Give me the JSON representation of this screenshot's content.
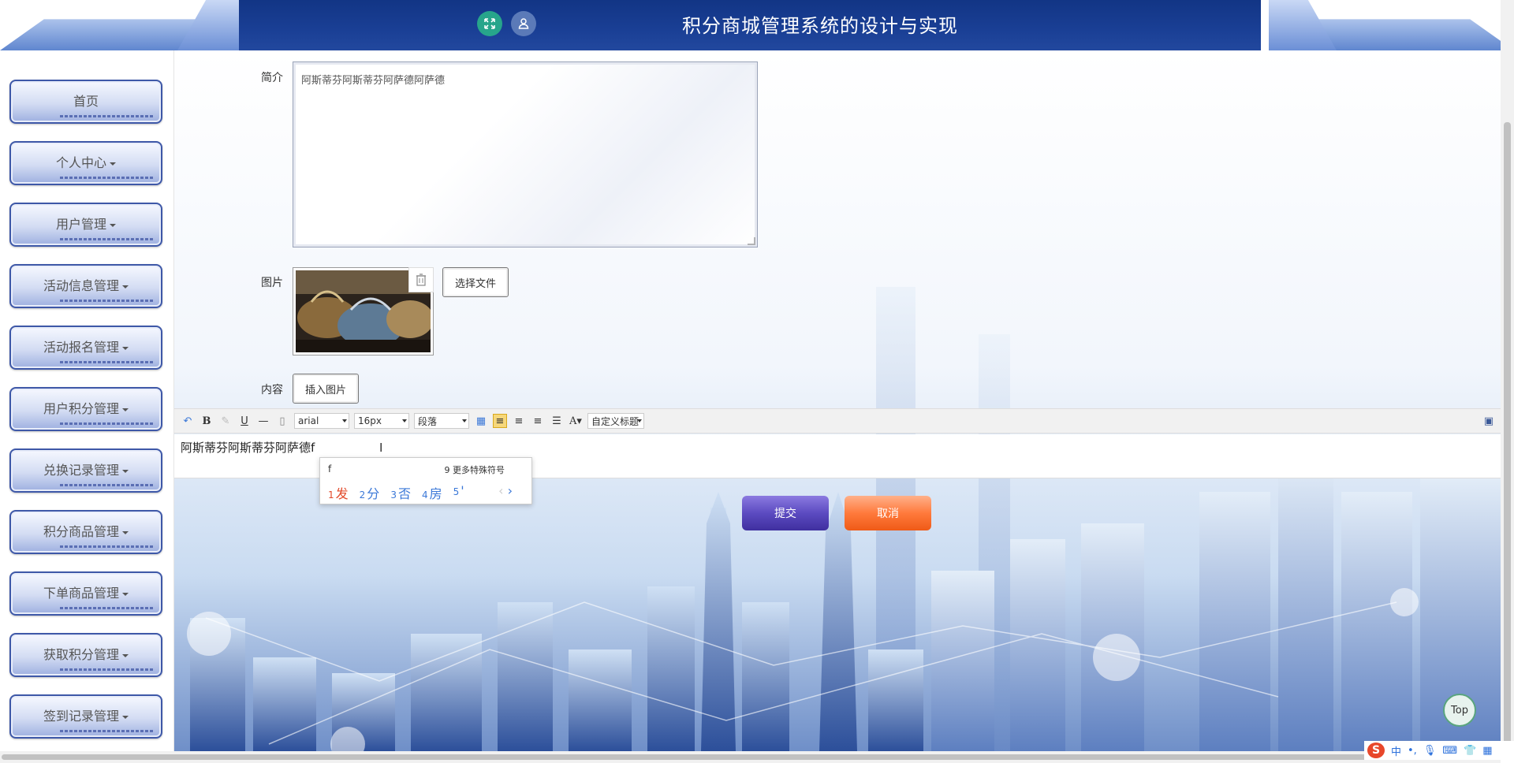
{
  "header": {
    "title": "积分商城管理系统的设计与实现",
    "fullscreen_icon": "expand-icon",
    "user_icon": "user-icon",
    "accent": "#1a3f95"
  },
  "sidebar": {
    "items": [
      {
        "label": "首页",
        "has_caret": false
      },
      {
        "label": "个人中心",
        "has_caret": true
      },
      {
        "label": "用户管理",
        "has_caret": true
      },
      {
        "label": "活动信息管理",
        "has_caret": true
      },
      {
        "label": "活动报名管理",
        "has_caret": true
      },
      {
        "label": "用户积分管理",
        "has_caret": true
      },
      {
        "label": "兑换记录管理",
        "has_caret": true
      },
      {
        "label": "积分商品管理",
        "has_caret": true
      },
      {
        "label": "下单商品管理",
        "has_caret": true
      },
      {
        "label": "获取积分管理",
        "has_caret": true
      },
      {
        "label": "签到记录管理",
        "has_caret": true
      }
    ]
  },
  "form": {
    "intro_label": "简介",
    "intro_value": "阿斯蒂芬阿斯蒂芬阿萨德阿萨德",
    "image_label": "图片",
    "choose_file": "选择文件",
    "content_label": "内容",
    "insert_image": "插入图片"
  },
  "toolbar": {
    "font_family": "arial",
    "font_size": "16px",
    "paragraph": "段落",
    "custom_title": "自定义标题"
  },
  "editor": {
    "content": "阿斯蒂芬阿斯蒂芬阿萨德f"
  },
  "ime": {
    "input": "f",
    "more": "9 更多特殊符号",
    "candidates": [
      {
        "n": "1",
        "t": "发"
      },
      {
        "n": "2",
        "t": "分"
      },
      {
        "n": "3",
        "t": "否"
      },
      {
        "n": "4",
        "t": "房"
      },
      {
        "n": "5",
        "t": "'"
      }
    ],
    "prev": "‹",
    "next": "›"
  },
  "actions": {
    "submit": "提交",
    "cancel": "取消",
    "top": "Top"
  },
  "tray": {
    "ime_mode": "中",
    "punct": "•,"
  }
}
